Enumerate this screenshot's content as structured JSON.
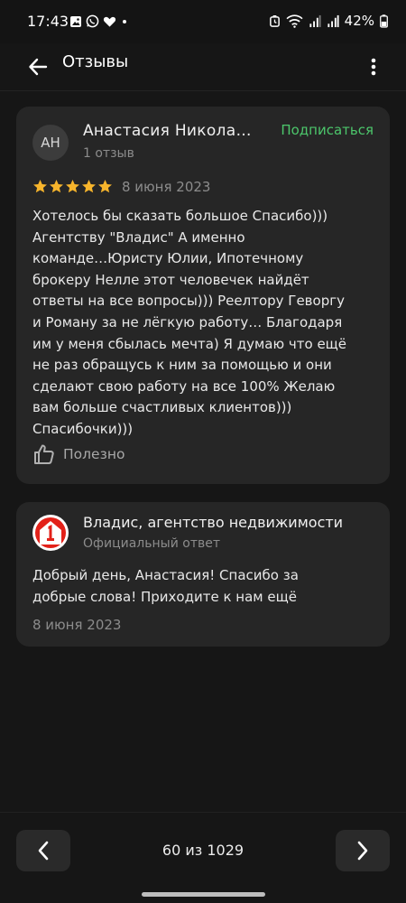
{
  "status_bar": {
    "time": "17:43",
    "battery": "42%",
    "left_icons": [
      "gallery-icon",
      "whatsapp-icon",
      "heart-icon",
      "dot-icon"
    ],
    "right_icons": [
      "alarm-icon",
      "wifi-icon",
      "signal-icon",
      "signal-icon",
      "battery-icon"
    ]
  },
  "app_bar": {
    "title": "Отзывы",
    "back_icon": "arrow-left-icon",
    "menu_icon": "more-vertical-icon"
  },
  "review": {
    "avatar_initials": "АН",
    "author": "Анастасия Никола…",
    "reviews_count": "1 отзыв",
    "subscribe_label": "Подписаться",
    "rating": 5,
    "rating_max": 5,
    "date": "8 июня 2023",
    "text_lines": [
      "Хотелось бы сказать большое Спасибо)))",
      "Агентству \"Владис\" А именно",
      "команде…Юристу Юлии, Ипотечному",
      "брокеру Нелле этот человечек найдёт",
      "ответы на все вопросы))) Реелтору Геворгу",
      "и Роману за не лёгкую работу… Благодаря",
      "им у меня сбылась мечта) Я думаю что ещё",
      "не раз обращусь к ним за помощью и они",
      "сделают свою работу на все 100% Желаю",
      "вам больше счастливых клиентов)))",
      "Спасибочки)))"
    ],
    "useful_label": "Полезно"
  },
  "reply": {
    "org_name": "Владис, агентство недвижимости",
    "official_label": "Официальный ответ",
    "text_lines": [
      "Добрый день, Анастасия! Спасибо за",
      "добрые слова! Приходите к нам ещё"
    ],
    "date": "8 июня 2023"
  },
  "pager": {
    "text": "60 из 1029",
    "prev_icon": "chevron-left-icon",
    "next_icon": "chevron-right-icon"
  },
  "colors": {
    "background": "#161616",
    "card": "#262626",
    "accent_green": "#4cc66b",
    "star": "#f7b52c",
    "logo_red": "#e32119"
  }
}
